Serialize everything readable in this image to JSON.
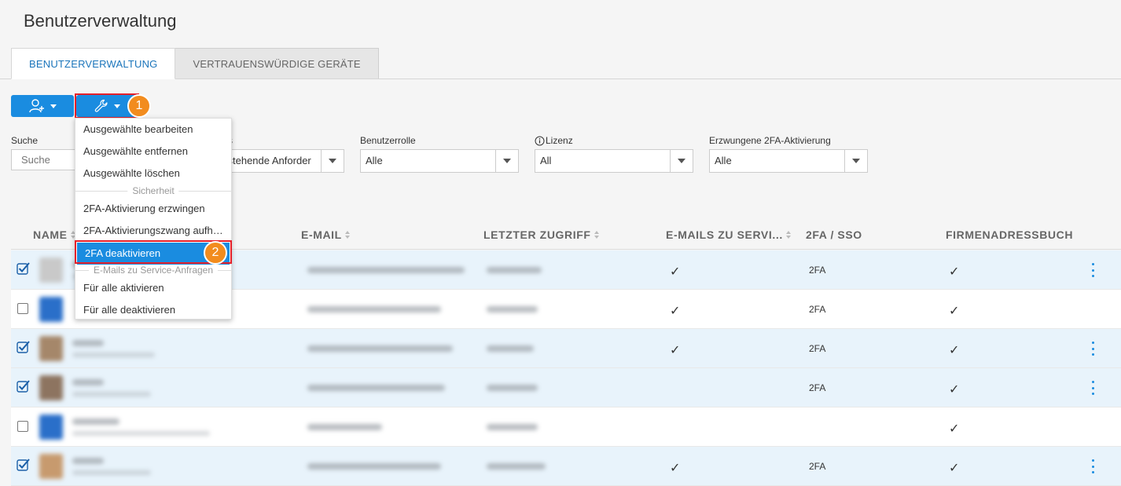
{
  "page": {
    "title": "Benutzerverwaltung"
  },
  "tabs": [
    {
      "label": "BENUTZERVERWALTUNG",
      "active": true
    },
    {
      "label": "VERTRAUENSWÜRDIGE GERÄTE",
      "active": false
    }
  ],
  "toolbar": {
    "add_user_icon": "add-user-icon",
    "tools_icon": "wrench-icon"
  },
  "callouts": {
    "step1": "1",
    "step2": "2"
  },
  "filters": {
    "search": {
      "label": "Suche",
      "placeholder": "Suche"
    },
    "status": {
      "label": "s",
      "value": "sstehende Anforder"
    },
    "role": {
      "label": "Benutzerrolle",
      "value": "Alle"
    },
    "license": {
      "label": "Lizenz",
      "value": "All",
      "info_icon": "info-icon"
    },
    "enforced_2fa": {
      "label": "Erzwungene 2FA-Aktivierung",
      "value": "Alle"
    }
  },
  "dropdown": {
    "items_top": [
      "Ausgewählte bearbeiten",
      "Ausgewählte entfernen",
      "Ausgewählte löschen"
    ],
    "section_security": "Sicherheit",
    "items_security": [
      "2FA-Aktivierung erzwingen",
      "2FA-Aktivierungszwang aufhe...",
      "2FA deaktivieren"
    ],
    "section_email": "E-Mails zu Service-Anfragen",
    "items_email": [
      "Für alle aktivieren",
      "Für alle deaktivieren"
    ],
    "highlighted": "2FA deaktivieren"
  },
  "table": {
    "columns": [
      "NAME",
      "E-MAIL",
      "LETZTER ZUGRIFF",
      "E-MAILS ZU SERVI...",
      "2FA / SSO",
      "FIRMENADRESSBUCH"
    ],
    "rows": [
      {
        "selected": true,
        "email_service": "✓",
        "twofa": "2FA",
        "address_book": "✓",
        "menu": true
      },
      {
        "selected": false,
        "email_service": "✓",
        "twofa": "2FA",
        "address_book": "✓",
        "menu": false
      },
      {
        "selected": true,
        "email_service": "✓",
        "twofa": "2FA",
        "address_book": "✓",
        "menu": true
      },
      {
        "selected": true,
        "email_service": "",
        "twofa": "2FA",
        "address_book": "✓",
        "menu": true
      },
      {
        "selected": false,
        "email_service": "",
        "twofa": "",
        "address_book": "✓",
        "menu": false
      },
      {
        "selected": true,
        "email_service": "✓",
        "twofa": "2FA",
        "address_book": "✓",
        "menu": true
      }
    ]
  },
  "colors": {
    "accent": "#1a8ce0",
    "highlight": "#e5202a",
    "callout": "#f28c1e",
    "row_selected": "#e8f3fb"
  }
}
